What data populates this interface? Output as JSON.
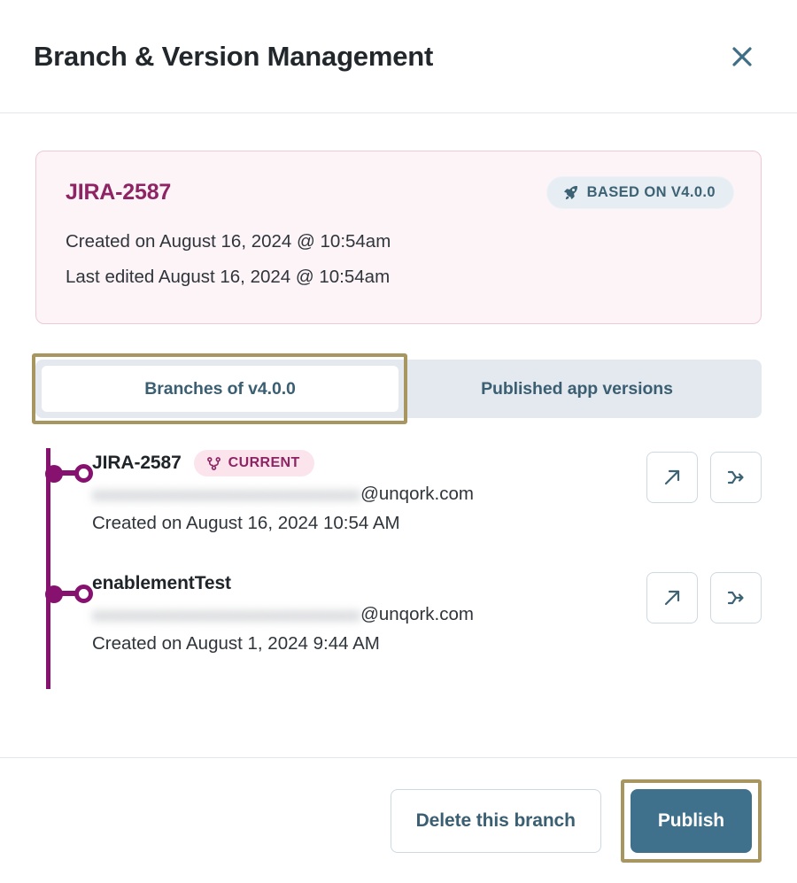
{
  "header": {
    "title": "Branch & Version Management",
    "close_label": "×"
  },
  "info_card": {
    "branch_name": "JIRA-2587",
    "badge": {
      "label": "BASED ON V4.0.0",
      "icon": "rocket-icon"
    },
    "created_line": "Created on August 16, 2024 @ 10:54am",
    "edited_line": "Last edited August 16, 2024 @ 10:54am"
  },
  "tabs": [
    {
      "label": "Branches of v4.0.0",
      "active": true
    },
    {
      "label": "Published app versions",
      "active": false
    }
  ],
  "branches": [
    {
      "name": "JIRA-2587",
      "badge": "CURRENT",
      "badge_icon": "git-branch-icon",
      "email_redacted": "xxxxxxxxxxxxxxxxxxxxxxxxxxxxx",
      "email_domain": "@unqork.com",
      "created": "Created on August 16, 2024 10:54 AM",
      "actions": [
        {
          "name": "open-branch-button",
          "icon": "arrow-up-right-icon"
        },
        {
          "name": "merge-branch-button",
          "icon": "merge-icon"
        }
      ]
    },
    {
      "name": "enablementTest",
      "badge": "",
      "badge_icon": "",
      "email_redacted": "xxxxxxxxxxxxxxxxxxxxxxxxxxxxx",
      "email_domain": "@unqork.com",
      "created": "Created on August 1, 2024 9:44 AM",
      "actions": [
        {
          "name": "open-branch-button",
          "icon": "arrow-up-right-icon"
        },
        {
          "name": "merge-branch-button",
          "icon": "merge-icon"
        }
      ]
    }
  ],
  "footer": {
    "delete_label": "Delete this branch",
    "publish_label": "Publish"
  },
  "colors": {
    "accent_purple": "#86116e",
    "title_purple": "#8e2463",
    "teal": "#3c6274",
    "primary_button": "#40718c",
    "focus_gold": "#a89660",
    "card_bg": "#fdf4f7",
    "card_border": "#edc9d6",
    "tab_bg": "#e3e9ee",
    "badge_pink": "#fbe4ec"
  }
}
